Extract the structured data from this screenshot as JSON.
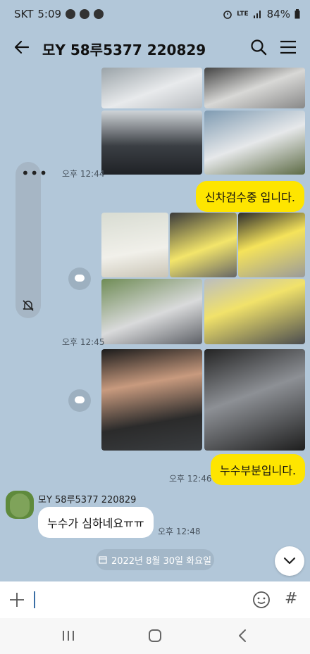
{
  "status_bar": {
    "carrier": "SKT",
    "time": "5:09",
    "network": "LTE",
    "battery": "84%"
  },
  "header": {
    "title": "모Y 58루5377 220829"
  },
  "messages": {
    "time_1": "오후 12:44",
    "text_1": "신차검수중 입니다.",
    "time_2": "오후 12:45",
    "time_3": "오후 12:46",
    "text_2": "누수부분입니다.",
    "sender_name": "모Y 58루5377 220829",
    "text_3": "누수가 심하네요ㅠㅠ",
    "time_4": "오후 12:48"
  },
  "date_chip": {
    "label": "2022년 8월 30일 화요일"
  },
  "input_bar": {
    "hash": "#"
  },
  "icons": {
    "back": "arrow-left-icon",
    "search": "search-icon",
    "menu": "menu-icon",
    "share": "share-icon",
    "plus": "plus-icon",
    "emoji": "emoji-icon",
    "calendar": "calendar-icon",
    "scroll_down": "chevron-down-icon",
    "mute": "bell-off-icon"
  },
  "colors": {
    "background": "#b2c7d9",
    "my_bubble": "#fee500",
    "other_bubble": "#ffffff"
  }
}
